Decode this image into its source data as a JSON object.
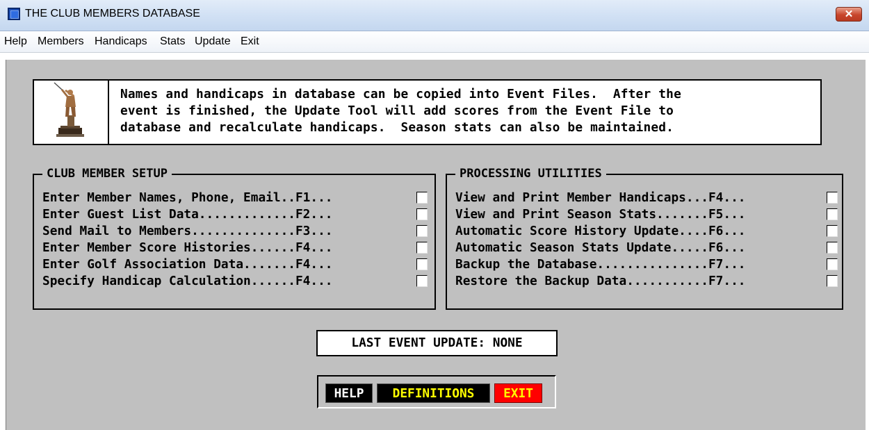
{
  "window": {
    "title": "THE CLUB MEMBERS DATABASE",
    "close_label": "✕"
  },
  "menu": [
    "Help",
    "Members",
    "Handicaps",
    "Stats",
    "Update",
    "Exit"
  ],
  "info": {
    "lines": [
      "Names and handicaps in database can be copied into Event Files.  After the",
      "event is finished, the Update Tool will add scores from the Event File to",
      "database and recalculate handicaps.  Season stats can also be maintained."
    ]
  },
  "setup": {
    "title": "CLUB MEMBER SETUP",
    "items": [
      "Enter Member Names, Phone, Email..F1...",
      "Enter Guest List Data.............F2...",
      "Send Mail to Members..............F3...",
      "Enter Member Score Histories......F4...",
      "Enter Golf Association Data.......F4...",
      "Specify Handicap Calculation......F4..."
    ]
  },
  "utilities": {
    "title": "PROCESSING UTILITIES",
    "items": [
      "View and Print Member Handicaps...F4...",
      "View and Print Season Stats.......F5...",
      "Automatic Score History Update....F6...",
      "Automatic Season Stats Update.....F6...",
      "Backup the Database...............F7...",
      "Restore the Backup Data...........F7..."
    ]
  },
  "last_update": "LAST EVENT UPDATE: NONE",
  "buttons": {
    "help": "HELP",
    "definitions": "DEFINITIONS",
    "exit": "EXIT"
  },
  "colors": {
    "client_bg": "#c0c0c0",
    "definitions_text": "#ffff00",
    "exit_bg": "#ff0000"
  },
  "icons": {
    "app": "app-window-icon",
    "trophy": "golfer-trophy-icon"
  }
}
